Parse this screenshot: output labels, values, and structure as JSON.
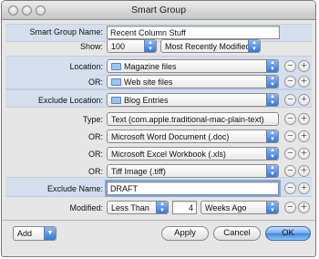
{
  "window": {
    "title": "Smart Group"
  },
  "rows": {
    "name": {
      "label": "Smart Group Name:",
      "value": "Recent Column Stuff"
    },
    "show": {
      "label": "Show:",
      "count": "100",
      "order": "Most Recently Modified"
    },
    "location": {
      "label": "Location:",
      "value": "Magazine files"
    },
    "location_or": {
      "label": "OR:",
      "value": "Web site files"
    },
    "exclude_location": {
      "label": "Exclude Location:",
      "value": "Blog Entries"
    },
    "type": {
      "label": "Type:",
      "value": "Text (com.apple.traditional-mac-plain-text)"
    },
    "type_or_1": {
      "label": "OR:",
      "value": "Microsoft Word Document (.doc)"
    },
    "type_or_2": {
      "label": "OR:",
      "value": "Microsoft Excel Workbook (.xls)"
    },
    "type_or_3": {
      "label": "OR:",
      "value": "Tiff Image (.tiff)"
    },
    "exclude_name": {
      "label": "Exclude Name:",
      "value": "DRAFT"
    },
    "modified": {
      "label": "Modified:",
      "operator": "Less Than",
      "amount": "4",
      "unit": "Weeks Ago"
    }
  },
  "icons": {
    "minus": "−",
    "plus": "+"
  },
  "footer": {
    "add": "Add",
    "apply": "Apply",
    "cancel": "Cancel",
    "ok": "OK"
  },
  "colors": {
    "accent": "#3f84df",
    "band": "#d4deed"
  }
}
